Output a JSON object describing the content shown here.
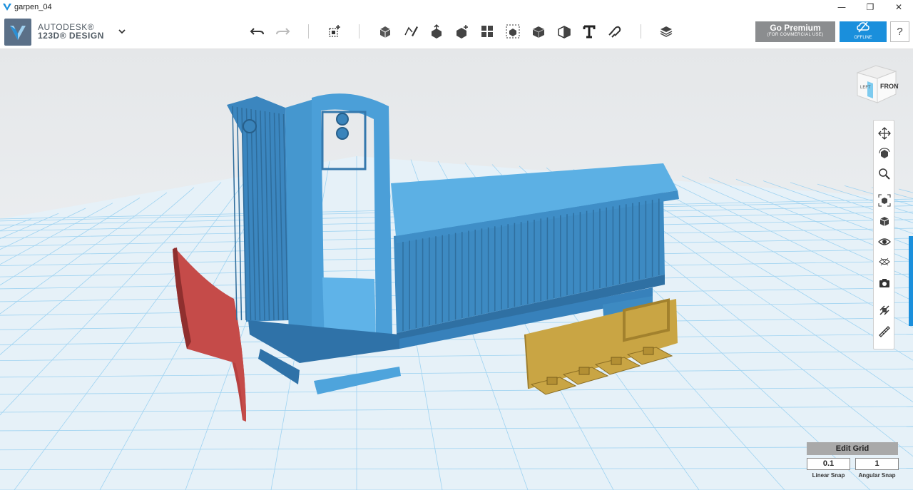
{
  "window": {
    "title": "garpen_04",
    "minimize": "—",
    "maximize": "❐",
    "close": "✕"
  },
  "brand": {
    "line1": "AUTODESK®",
    "line2": "123D® DESIGN",
    "menu_icon": "chevron-down-icon"
  },
  "toolbar": {
    "undo_icon": "undo-icon",
    "redo_icon": "redo-icon",
    "tools": [
      "transform-icon",
      "primitives-icon",
      "sketch-icon",
      "construct-icon",
      "modify-icon",
      "pattern-icon",
      "group-icon",
      "combine-icon",
      "measure-icon",
      "text-icon",
      "snap-icon",
      "materials-icon"
    ],
    "premium": {
      "title": "Go Premium",
      "subtitle": "(FOR COMMERCIAL USE)"
    },
    "offline_label": "OFFLINE",
    "help_label": "?"
  },
  "viewcube": {
    "front": "FRONT",
    "left": "LEFT"
  },
  "nav": [
    "pan-icon",
    "orbit-icon",
    "zoom-icon",
    "fit-icon",
    "views-icon",
    "visibility-icon",
    "material-icon",
    "screenshot-icon",
    "snap-icon",
    "ruler-icon"
  ],
  "edit_grid": {
    "button": "Edit Grid",
    "linear_snap": "0.1",
    "angular_snap": "1",
    "linear_label": "Linear Snap",
    "angular_label": "Angular Snap"
  },
  "colors": {
    "accent": "#1a8fdc",
    "model_blue": "#4d9fd6",
    "model_red": "#b7403f",
    "model_gold": "#c9a544",
    "grid_line": "#88c8ee",
    "viewport_bg": "#f0f2f4"
  }
}
